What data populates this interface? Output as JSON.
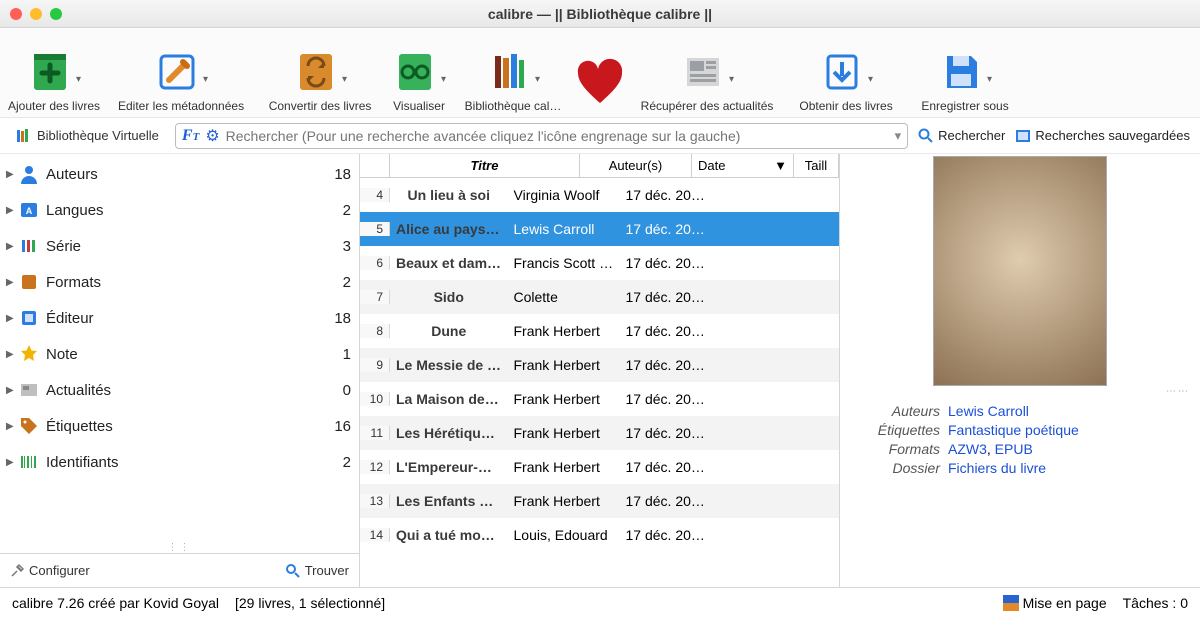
{
  "window": {
    "title": "calibre — || Bibliothèque calibre ||"
  },
  "toolbar": [
    {
      "label": "Ajouter des livres",
      "icon": "add-book"
    },
    {
      "label": "Editer les métadonnées",
      "icon": "edit-meta"
    },
    {
      "label": "Convertir des livres",
      "icon": "convert"
    },
    {
      "label": "Visualiser",
      "icon": "view"
    },
    {
      "label": "Bibliothèque cal…",
      "icon": "library"
    },
    {
      "label": "",
      "icon": "heart"
    },
    {
      "label": "Récupérer des actualités",
      "icon": "news"
    },
    {
      "label": "Obtenir des livres",
      "icon": "get"
    },
    {
      "label": "Enregistrer sous",
      "icon": "save"
    }
  ],
  "search": {
    "virtual_library": "Bibliothèque Virtuelle",
    "placeholder": "Rechercher (Pour une recherche avancée cliquez l'icône engrenage sur la gauche)",
    "search_btn": "Rechercher",
    "saved_btn": "Recherches sauvegardées"
  },
  "categories": [
    {
      "name": "Auteurs",
      "count": 18,
      "icon": "person"
    },
    {
      "name": "Langues",
      "count": 2,
      "icon": "langs"
    },
    {
      "name": "Série",
      "count": 3,
      "icon": "series"
    },
    {
      "name": "Formats",
      "count": 2,
      "icon": "formats"
    },
    {
      "name": "Éditeur",
      "count": 18,
      "icon": "publisher"
    },
    {
      "name": "Note",
      "count": 1,
      "icon": "star"
    },
    {
      "name": "Actualités",
      "count": 0,
      "icon": "news"
    },
    {
      "name": "Étiquettes",
      "count": 16,
      "icon": "tag"
    },
    {
      "name": "Identifiants",
      "count": 2,
      "icon": "barcode"
    }
  ],
  "sidebar_bottom": {
    "configure": "Configurer",
    "find": "Trouver"
  },
  "columns": {
    "title": "Titre",
    "author": "Auteur(s)",
    "date": "Date",
    "size": "Taill"
  },
  "rows": [
    {
      "n": 4,
      "title": "Un lieu à soi",
      "author": "Virginia Woolf",
      "date": "17 déc. 20…"
    },
    {
      "n": 5,
      "title": "Alice au pays des merveil…",
      "author": "Lewis Carroll",
      "date": "17 déc. 20…",
      "selected": true
    },
    {
      "n": 6,
      "title": "Beaux et damnés",
      "author": "Francis Scott …",
      "date": "17 déc. 20…"
    },
    {
      "n": 7,
      "title": "Sido",
      "author": "Colette",
      "date": "17 déc. 20…"
    },
    {
      "n": 8,
      "title": "Dune",
      "author": "Frank Herbert",
      "date": "17 déc. 20…"
    },
    {
      "n": 9,
      "title": "Le Messie de Dune",
      "author": "Frank Herbert",
      "date": "17 déc. 20…"
    },
    {
      "n": 10,
      "title": "La Maison des Mères",
      "author": "Frank Herbert",
      "date": "17 déc. 20…"
    },
    {
      "n": 11,
      "title": "Les Hérétiques de Dune",
      "author": "Frank Herbert",
      "date": "17 déc. 20…"
    },
    {
      "n": 12,
      "title": "L'Empereur-Dieu de Dune",
      "author": "Frank Herbert",
      "date": "17 déc. 20…"
    },
    {
      "n": 13,
      "title": "Les Enfants de Dune",
      "author": "Frank Herbert",
      "date": "17 déc. 20…"
    },
    {
      "n": 14,
      "title": "Qui a tué mon père",
      "author": "Louis, Edouard",
      "date": "17 déc. 20…"
    }
  ],
  "detail": {
    "authors_label": "Auteurs",
    "authors": "Lewis Carroll",
    "tags_label": "Étiquettes",
    "tags": "Fantastique poétique",
    "formats_label": "Formats",
    "format1": "AZW3",
    "format2": "EPUB",
    "folder_label": "Dossier",
    "folder": "Fichiers du livre"
  },
  "status": {
    "left": "calibre 7.26 créé par Kovid Goyal",
    "count": "[29 livres, 1 sélectionné]",
    "layout": "Mise en page",
    "tasks": "Tâches : 0"
  }
}
